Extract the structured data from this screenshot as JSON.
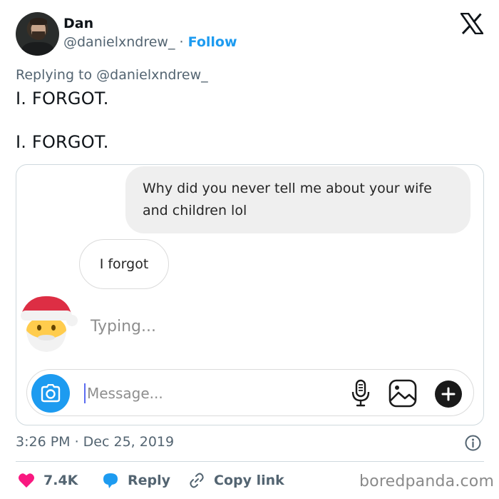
{
  "tweet": {
    "author": {
      "name": "Dan",
      "handle": "@danielxndrew_",
      "separator": "·",
      "follow_label": "Follow"
    },
    "replying_to": "Replying to @danielxndrew_",
    "lines": [
      "I. FORGOT.",
      "I. FORGOT."
    ],
    "timestamp": "3:26 PM · Dec 25, 2019",
    "actions": {
      "likes": "7.4K",
      "reply_label": "Reply",
      "copy_link_label": "Copy link"
    }
  },
  "chat": {
    "sent_message": "Why did you never tell me about your wife and children lol",
    "received_message": "I forgot",
    "typing_indicator": "Typing...",
    "input_placeholder": "Message...",
    "avatar_icon": "santa-emoji-icon"
  },
  "watermark": "boredpanda.com",
  "colors": {
    "follow": "#1d9bf0",
    "like": "#f91880",
    "reply_icon": "#1d9bf0",
    "camera_button": "#1d9bf0",
    "muted": "#536471"
  }
}
